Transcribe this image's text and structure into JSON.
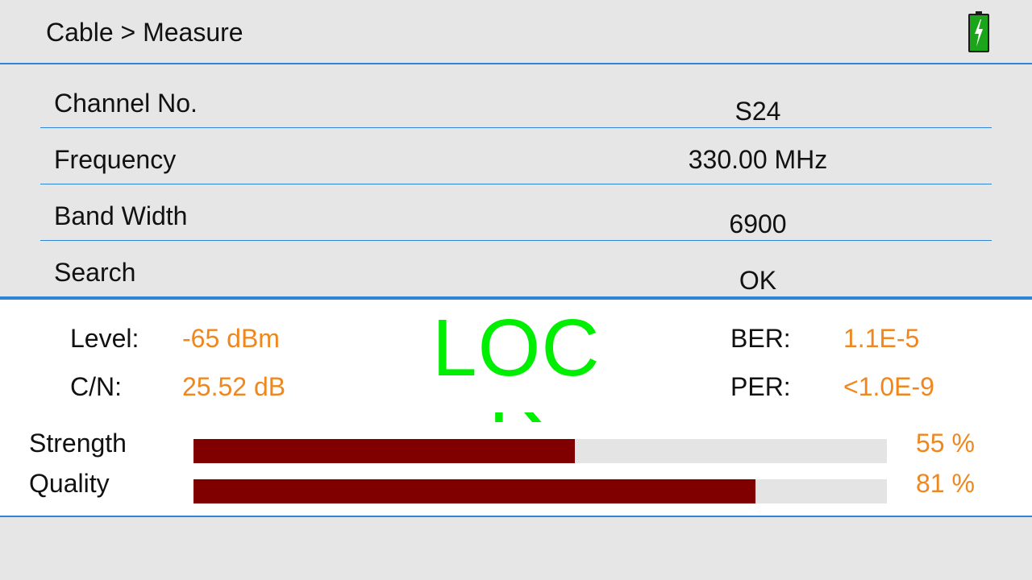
{
  "header": {
    "breadcrumb": "Cable > Measure",
    "battery_icon": "battery-charging-icon",
    "battery_color": "#1aa51a"
  },
  "info_rows": [
    {
      "label": "Channel No.",
      "value": "S24"
    },
    {
      "label": "Frequency",
      "value": "330.00 MHz"
    },
    {
      "label": "Band Width",
      "value": "6900"
    },
    {
      "label": "Search",
      "value": "OK"
    }
  ],
  "measure": {
    "level_label": "Level:",
    "level_value": "-65 dBm",
    "cn_label": "C/N:",
    "cn_value": "25.52 dB",
    "ber_label": "BER:",
    "ber_value": "1.1E-5",
    "per_label": "PER:",
    "per_value": "<1.0E-9",
    "lock_text": "LOC",
    "lock_color": "#00ee00",
    "value_color": "#f0861e"
  },
  "bars": {
    "strength_label": "Strength",
    "strength_percent_text": "55 %",
    "strength_value": 0.55,
    "quality_label": "Quality",
    "quality_percent_text": "81 %",
    "quality_value": 0.81,
    "fill_color": "#800000"
  }
}
